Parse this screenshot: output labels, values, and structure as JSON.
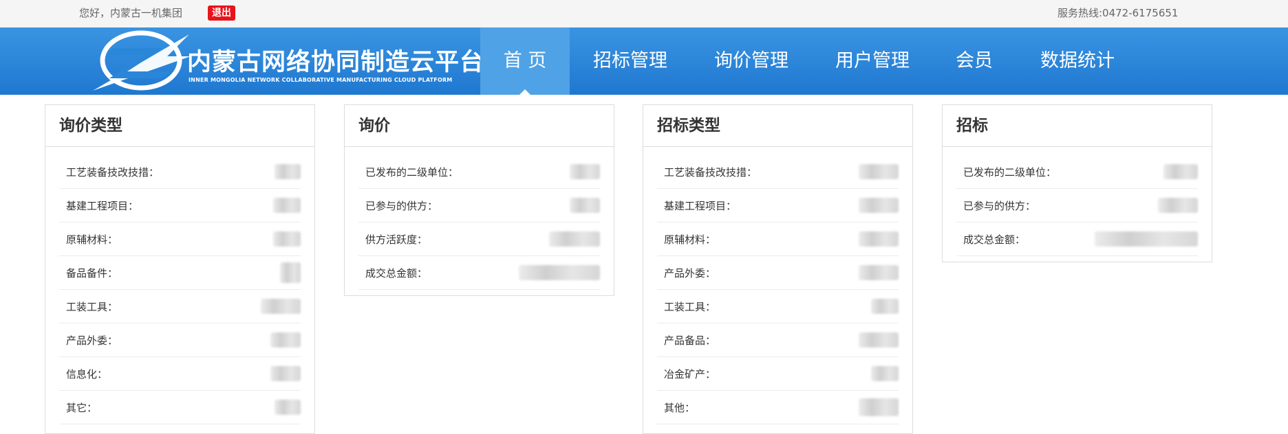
{
  "topbar": {
    "greeting": "您好，内蒙古一机集团",
    "logout_label": "退出",
    "hotline": "服务热线:0472-6175651"
  },
  "header": {
    "logo_title": "内蒙古网络协同制造云平台",
    "logo_subtitle": "INNER MONGOLIA NETWORK COLLABORATIVE MANUFACTURING CLOUD PLATFORM",
    "nav": [
      "首 页",
      "招标管理",
      "询价管理",
      "用户管理",
      "会员",
      "数据统计"
    ],
    "active_nav": "首 页"
  },
  "colors": {
    "header_blue": "#2a86d8",
    "active_tab": "#4fa2e6",
    "logout_red": "#e8141b"
  },
  "panels": [
    {
      "title": "询价类型",
      "rows": [
        "工艺装备技改技措：",
        "基建工程项目：",
        "原辅材料：",
        "备品备件：",
        "工装工具：",
        "产品外委：",
        "信息化：",
        "其它："
      ]
    },
    {
      "title": "询价",
      "rows": [
        "已发布的二级单位：",
        "已参与的供方：",
        "供方活跃度：",
        "成交总金额："
      ]
    },
    {
      "title": "招标类型",
      "rows": [
        "工艺装备技改技措：",
        "基建工程项目：",
        "原辅材料：",
        "产品外委：",
        "工装工具：",
        "产品备品：",
        "冶金矿产：",
        "其他："
      ]
    },
    {
      "title": "招标",
      "rows": [
        "已发布的二级单位：",
        "已参与的供方：",
        "成交总金额："
      ]
    }
  ]
}
